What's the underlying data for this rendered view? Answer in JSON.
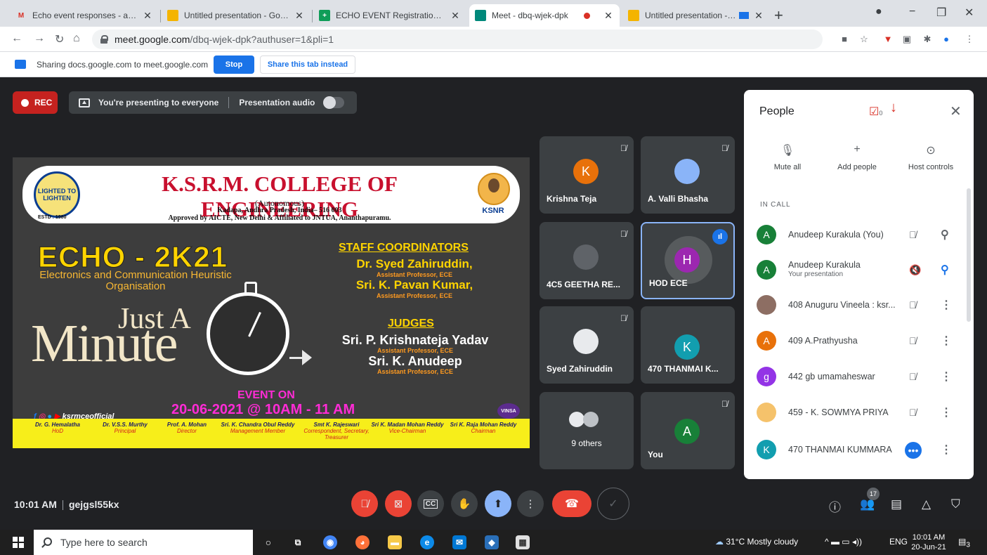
{
  "browser": {
    "tabs": [
      {
        "title": "Echo event responses - anudeep",
        "favicon": "gmail-icon",
        "favicon_text": "M",
        "favicon_color": "#d93025"
      },
      {
        "title": "Untitled presentation - Google S",
        "favicon": "slides-icon",
        "favicon_text": "",
        "favicon_color": "#f4b400"
      },
      {
        "title": "ECHO EVENT Registration for JA",
        "favicon": "sheets-icon",
        "favicon_text": "+",
        "favicon_color": "#0f9d58"
      },
      {
        "title": "Meet - dbq-wjek-dpk",
        "favicon": "meet-icon",
        "favicon_text": "",
        "favicon_color": "#00897b"
      },
      {
        "title": "Untitled presentation - Goog",
        "favicon": "slides-icon",
        "favicon_text": "",
        "favicon_color": "#f4b400"
      }
    ],
    "url_host": "meet.google.com",
    "url_path": "/dbq-wjek-dpk?authuser=1&pli=1"
  },
  "sharebar": {
    "text": "Sharing docs.google.com to meet.google.com",
    "stop_label": "Stop",
    "share_tab_label": "Share this tab instead"
  },
  "meet_top": {
    "rec_label": "REC",
    "presenting_text": "You're presenting to everyone",
    "audio_label": "Presentation audio"
  },
  "slide": {
    "college": "K.S.R.M. COLLEGE OF ENGINEERING",
    "autonomous": "(Autonomous)",
    "address": "Kadapa, Andhra Pradesh, India– 516 003",
    "approved": "Approved by AICTE, New Delhi & Affiliated to JNTUA, Ananthapuramu.",
    "estd": "ESTD : 1980",
    "ksnr": "KSNR",
    "seal_text": "LIGHTED TO LIGHTEN",
    "event_title": "ECHO - 2K21",
    "event_sub": "Electronics and Communication Heuristic Organisation",
    "jam_just": "Just A",
    "jam_minute": "Minute",
    "staff_heading": "STAFF COORDINATORS",
    "staff": [
      {
        "name": "Dr. Syed Zahiruddin,",
        "role": "Assistant Professor, ECE"
      },
      {
        "name": "Sri. K. Pavan Kumar,",
        "role": "Assistant Professor, ECE"
      }
    ],
    "judges_heading": "JUDGES",
    "judges": [
      {
        "name": "Sri. P. Krishnateja Yadav",
        "role": "Assistant Professor, ECE"
      },
      {
        "name": "Sri. K. Anudeep",
        "role": "Assistant Professor, ECE"
      }
    ],
    "event_on": "EVENT ON",
    "event_datetime": "20-06-2021 @ 10AM - 11 AM",
    "social": "ksrmceofficial",
    "vinsa": "VINSA",
    "people": [
      {
        "name": "Dr. G. Hemalatha",
        "role": "HoD"
      },
      {
        "name": "Dr. V.S.S. Murthy",
        "role": "Principal"
      },
      {
        "name": "Prof. A. Mohan",
        "role": "Director"
      },
      {
        "name": "Sri. K. Chandra Obul Reddy",
        "role": "Management Member"
      },
      {
        "name": "Smt K. Rajeswari",
        "role": "Correspondent, Secretary, Treasurer"
      },
      {
        "name": "Sri K. Madan Mohan Reddy",
        "role": "Vice-Chairman"
      },
      {
        "name": "Sri K. Raja Mohan Reddy",
        "role": "Chairman"
      }
    ]
  },
  "tiles": [
    {
      "name": "Krishna Teja",
      "initial": "K",
      "color": "#e8710a"
    },
    {
      "name": "A. Valli Bhasha",
      "initial": "",
      "color": "#8ab4f8"
    },
    {
      "name": "4C5 GEETHA RE...",
      "initial": "",
      "color": "#5f6368"
    },
    {
      "name": "HOD ECE",
      "initial": "H",
      "color": "#9c27b0"
    },
    {
      "name": "Syed Zahiruddin",
      "initial": "",
      "color": "#e8eaed"
    },
    {
      "name": "470 THANMAI K...",
      "initial": "K",
      "color": "#129eaf"
    },
    {
      "name": "9 others",
      "initial": "",
      "color": "#5f6368"
    },
    {
      "name": "You",
      "initial": "A",
      "color": "#188038"
    }
  ],
  "panel": {
    "title": "People",
    "task_count": "0",
    "actions": [
      {
        "label": "Mute all",
        "icon": "mute-all-icon",
        "glyph": "🎙"
      },
      {
        "label": "Add people",
        "icon": "add-person-icon",
        "glyph": "+"
      },
      {
        "label": "Host controls",
        "icon": "host-controls-icon",
        "glyph": "⊙"
      }
    ],
    "in_call": "IN CALL",
    "participants": [
      {
        "name": "Anudeep Kurakula (You)",
        "sub": "",
        "initial": "A",
        "color": "#188038",
        "action": "pin-icon",
        "action_glyph": "⚲"
      },
      {
        "name": "Anudeep Kurakula",
        "sub": "Your presentation",
        "initial": "A",
        "color": "#188038",
        "action": "pinned-icon",
        "action_glyph": "⚲"
      },
      {
        "name": "408 Anuguru Vineela : ksr...",
        "sub": "",
        "initial": "",
        "color": "#8d6e63",
        "action": "more-icon",
        "action_glyph": "⋮"
      },
      {
        "name": "409 A.Prathyusha",
        "sub": "",
        "initial": "A",
        "color": "#e8710a",
        "action": "more-icon",
        "action_glyph": "⋮"
      },
      {
        "name": "442 gb umamaheswar",
        "sub": "",
        "initial": "g",
        "color": "#9334e6",
        "action": "more-icon",
        "action_glyph": "⋮"
      },
      {
        "name": "459 - K. SOWMYA PRIYA",
        "sub": "",
        "initial": "",
        "color": "#f5c26b",
        "action": "more-icon",
        "action_glyph": "⋮"
      },
      {
        "name": "470 THANMAI KUMMARA",
        "sub": "",
        "initial": "K",
        "color": "#129eaf",
        "action": "more-icon",
        "action_glyph": "⋮"
      }
    ]
  },
  "bottom": {
    "time": "10:01 AM",
    "meeting_code": "gejgsl55kx",
    "participant_count": "17"
  },
  "taskbar": {
    "search_placeholder": "Type here to search",
    "weather": "31°C  Mostly cloudy",
    "lang": "ENG",
    "clock_time": "10:01 AM",
    "clock_date": "20-Jun-21",
    "notif_count": "3"
  }
}
